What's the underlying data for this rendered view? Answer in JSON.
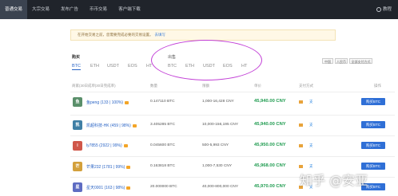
{
  "nav": {
    "tabs": [
      {
        "label": "普通交易"
      },
      {
        "label": "大宗交易"
      },
      {
        "label": "发布广告"
      },
      {
        "label": "币币交易"
      },
      {
        "label": "客户端下载"
      }
    ],
    "right_label": "教程"
  },
  "notice": {
    "text": "在开始交易之前，您需要完成必要的交易设置。",
    "link": "去填写"
  },
  "buy_section": {
    "label": "购买",
    "currencies": [
      "BTC",
      "ETH",
      "USDT",
      "EOS",
      "HT"
    ]
  },
  "sell_section": {
    "label": "出售",
    "currencies": [
      "BTC",
      "ETH",
      "USDT",
      "EOS",
      "HT"
    ]
  },
  "filters": [
    "中国",
    "人民币",
    "全部支付方式"
  ],
  "table": {
    "headers": [
      "商家(30日成单|30日完成率)",
      "数量",
      "限额",
      "单价",
      "支付方式",
      "操作"
    ],
    "rows": [
      {
        "avatar": "鱼",
        "avatar_color": "#5a8f6a",
        "user": "鱼peng (133 | 100%)",
        "amount": "0.147110 BTC",
        "limit": "1,000-16,428 CNY",
        "price": "45,940.00 CNY",
        "action": "购买BTC"
      },
      {
        "avatar": "凯",
        "avatar_color": "#3f7fa5",
        "user": "凯超科技-HK (459 | 98%)",
        "amount": "3.405285 BTC",
        "limit": "10,000-156,195 CNY",
        "price": "45,940.00 CNY",
        "action": "购买BTC"
      },
      {
        "avatar": "l",
        "avatar_color": "#d0574a",
        "user": "ly7855 (2922 | 99%)",
        "amount": "0.045600 BTC",
        "limit": "500-5,993 CNY",
        "price": "45,950.00 CNY",
        "action": "购买BTC"
      },
      {
        "avatar": "芒",
        "avatar_color": "#d3a03b",
        "user": "芒果232 (1781 | 99%)",
        "amount": "0.163818 BTC",
        "limit": "1,000-7,530 CNY",
        "price": "45,968.00 CNY",
        "action": "购买BTC"
      },
      {
        "avatar": "星",
        "avatar_color": "#5e6cc2",
        "user": "星天0001 (163 | 98%)",
        "amount": "20.000000 BTC",
        "limit": "40,000-800,000 CNY",
        "price": "45,970.00 CNY",
        "action": "购买BTC"
      }
    ]
  },
  "watermark": "知乎 @安亚"
}
